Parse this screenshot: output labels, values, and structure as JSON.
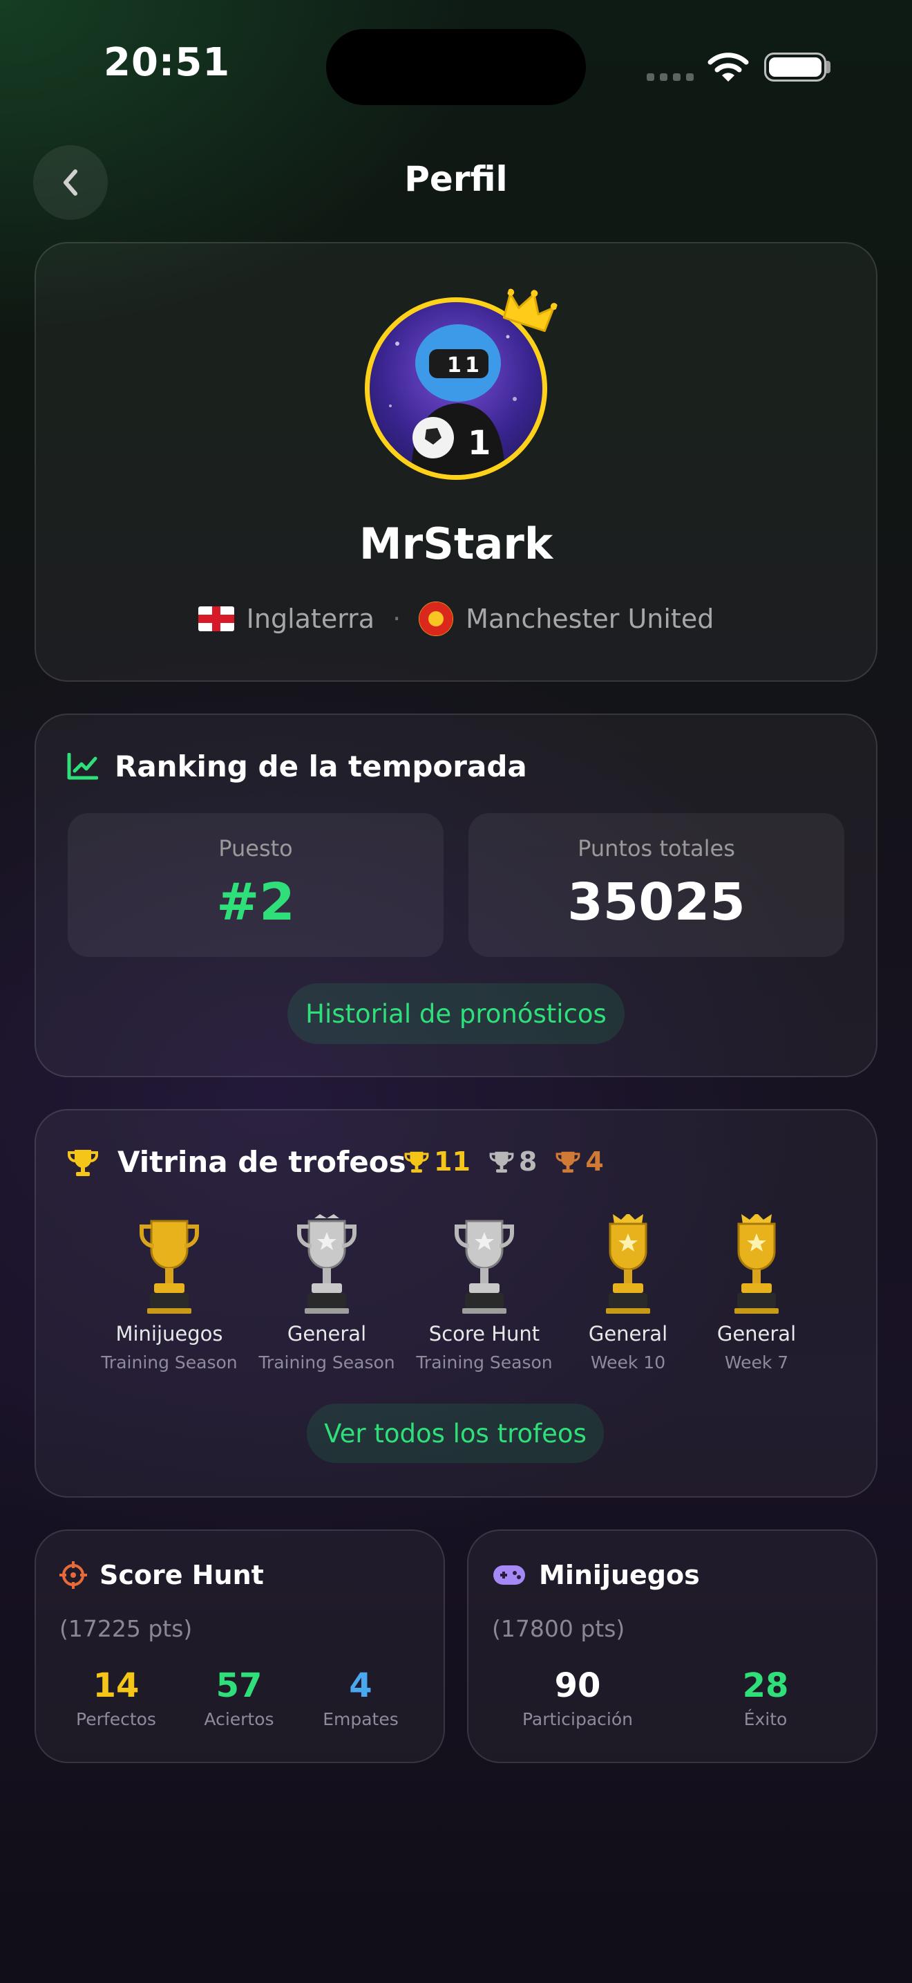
{
  "status_bar": {
    "time": "20:51"
  },
  "header": {
    "title": "Perfil"
  },
  "profile": {
    "username": "MrStark",
    "country": "Inglaterra",
    "separator": "·",
    "club": "Manchester United",
    "avatar_jersey_number": "1"
  },
  "ranking": {
    "title": "Ranking de la temporada",
    "position_label": "Puesto",
    "position_value": "#2",
    "points_label": "Puntos totales",
    "points_value": "35025",
    "history_button": "Historial de pronósticos"
  },
  "trophies": {
    "title": "Vitrina de trofeos",
    "gold_count": "11",
    "silver_count": "8",
    "bronze_count": "4",
    "items": [
      {
        "name": "Minijuegos",
        "season": "Training Season",
        "type": "gold"
      },
      {
        "name": "General",
        "season": "Training Season",
        "type": "silver"
      },
      {
        "name": "Score Hunt",
        "season": "Training Season",
        "type": "silver"
      },
      {
        "name": "General",
        "season": "Week 10",
        "type": "gold-crown"
      },
      {
        "name": "General",
        "season": "Week 7",
        "type": "gold-crown"
      }
    ],
    "view_all_button": "Ver todos los trofeos"
  },
  "score_hunt": {
    "title": "Score Hunt",
    "points": "(17225 pts)",
    "stats": [
      {
        "value": "14",
        "label": "Perfectos"
      },
      {
        "value": "57",
        "label": "Aciertos"
      },
      {
        "value": "4",
        "label": "Empates"
      }
    ]
  },
  "minigames": {
    "title": "Minijuegos",
    "points": "(17800 pts)",
    "stats": [
      {
        "value": "90",
        "label": "Participación"
      },
      {
        "value": "28",
        "label": "Éxito"
      }
    ]
  },
  "colors": {
    "accent_green": "#2fe07a",
    "gold": "#f5c518",
    "silver": "#b8b8b8",
    "bronze": "#d07a35",
    "blue": "#4aa8f0",
    "orange": "#e86a3a",
    "purple": "#a58af5"
  }
}
